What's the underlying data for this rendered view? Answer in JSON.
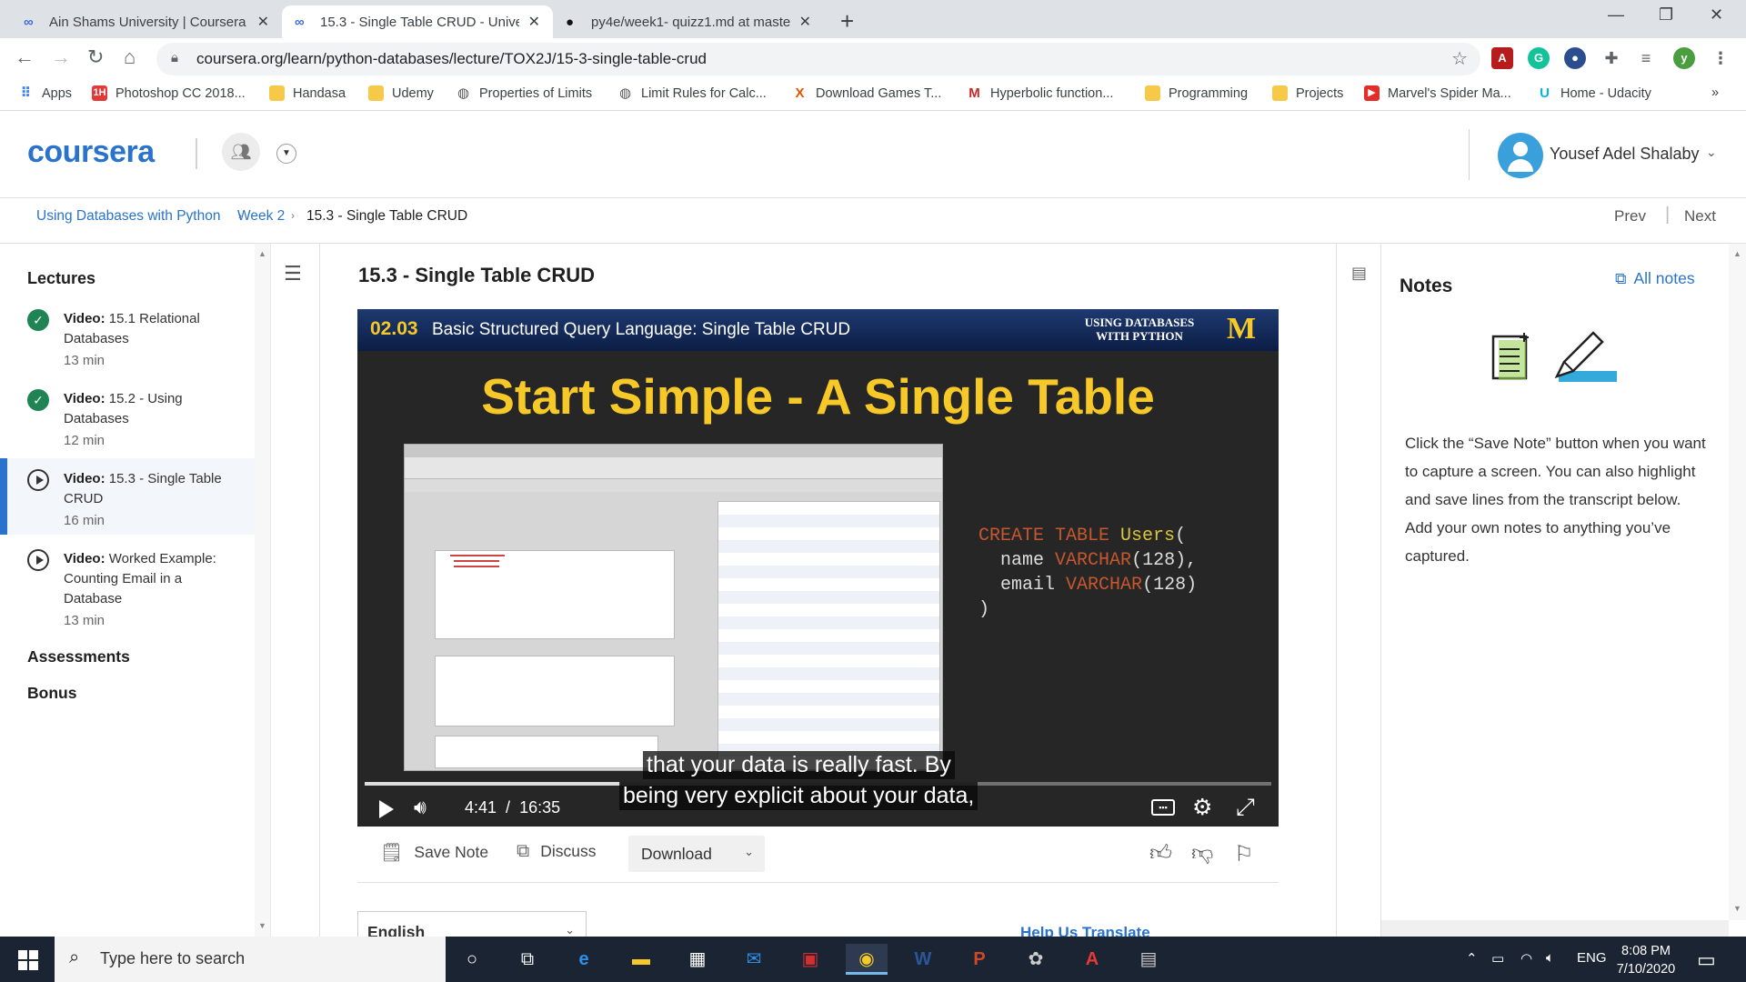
{
  "browser": {
    "tabs": [
      {
        "title": "Ain Shams University | Coursera",
        "active": false
      },
      {
        "title": "15.3 - Single Table CRUD - Unive",
        "active": true
      },
      {
        "title": "py4e/week1- quizz1.md at maste",
        "active": false
      }
    ],
    "url": "coursera.org/learn/python-databases/lecture/TOX2J/15-3-single-table-crud",
    "profile_initial": "y",
    "bookmarks": [
      {
        "label": "Apps"
      },
      {
        "label": "Photoshop CC 2018..."
      },
      {
        "label": "Handasa"
      },
      {
        "label": "Udemy"
      },
      {
        "label": "Properties of Limits"
      },
      {
        "label": "Limit Rules for Calc..."
      },
      {
        "label": "Download Games T..."
      },
      {
        "label": "Hyperbolic function..."
      },
      {
        "label": "Programming"
      },
      {
        "label": "Projects"
      },
      {
        "label": "Marvel's Spider Ma..."
      },
      {
        "label": "Home - Udacity"
      }
    ]
  },
  "header": {
    "logo": "coursera",
    "user_name": "Yousef Adel Shalaby"
  },
  "breadcrumb": {
    "items": [
      "Using Databases with Python",
      "Week 2",
      "15.3 - Single Table CRUD"
    ],
    "prev": "Prev",
    "next": "Next"
  },
  "sidebar": {
    "lectures_title": "Lectures",
    "items": [
      {
        "kind": "Video:",
        "title": "15.1 Relational Databases",
        "duration": "13 min",
        "status": "completed"
      },
      {
        "kind": "Video:",
        "title": "15.2 - Using Databases",
        "duration": "12 min",
        "status": "completed"
      },
      {
        "kind": "Video:",
        "title": "15.3 - Single Table CRUD",
        "duration": "16 min",
        "status": "current"
      },
      {
        "kind": "Video:",
        "title": "Worked Example: Counting Email in a Database",
        "duration": "13 min",
        "status": "not-started"
      }
    ],
    "assessments": "Assessments",
    "bonus": "Bonus"
  },
  "main": {
    "lecture_title": "15.3 - Single Table CRUD",
    "video": {
      "slide_number": "02.03",
      "slide_subtitle": "Basic Structured Query Language: Single Table CRUD",
      "brand_line1": "USING DATABASES",
      "brand_line2": "WITH PYTHON",
      "brand_mark": "M",
      "slide_title": "Start Simple - A Single Table",
      "sql": {
        "line1_kw": "CREATE TABLE",
        "line1_name": "Users",
        "col1": "name",
        "col1_type": "VARCHAR",
        "col1_size": "(128),",
        "col2": "email",
        "col2_type": "VARCHAR",
        "col2_size": "(128)",
        "close": ")"
      },
      "caption_line1": "that your data is really fast. By",
      "caption_line2": "being very explicit about your data,",
      "current_time": "4:41",
      "duration": "16:35",
      "progress_fraction": 0.282
    },
    "actions": {
      "save_note": "Save Note",
      "discuss": "Discuss",
      "download": "Download"
    },
    "transcript_language": "English",
    "help_translate": "Help Us Translate"
  },
  "notes": {
    "title": "Notes",
    "all_notes": "All notes",
    "description": "Click the “Save Note” button when you want to capture a screen. You can also highlight and save lines from the transcript below. Add your own notes to anything you’ve captured."
  },
  "taskbar": {
    "search_placeholder": "Type here to search",
    "language": "ENG",
    "time": "8:08 PM",
    "date": "7/10/2020"
  },
  "colors": {
    "coursera_blue": "#2a73cc",
    "completed_green": "#1f8354",
    "slide_yellow": "#f6c928"
  }
}
